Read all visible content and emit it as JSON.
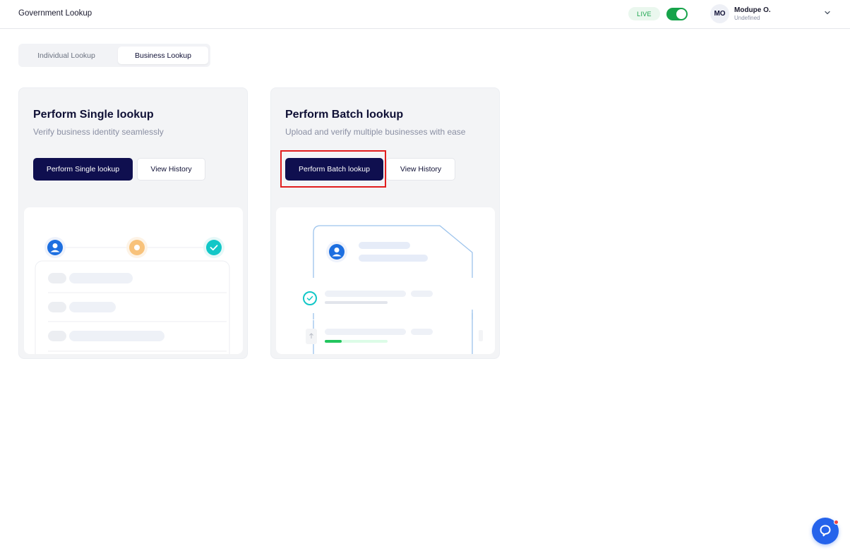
{
  "header": {
    "title": "Government Lookup",
    "live_label": "LIVE",
    "live_enabled": true,
    "user": {
      "initials": "MO",
      "name": "Modupe O.",
      "subtitle": "Undefined"
    }
  },
  "tabs": [
    {
      "label": "Individual Lookup",
      "active": false
    },
    {
      "label": "Business Lookup",
      "active": true
    }
  ],
  "cards": {
    "single": {
      "title": "Perform Single lookup",
      "subtitle": "Verify business identity seamlessly",
      "primary_label": "Perform Single lookup",
      "secondary_label": "View History"
    },
    "batch": {
      "title": "Perform Batch lookup",
      "subtitle": "Upload and verify multiple businesses with ease",
      "primary_label": "Perform Batch lookup",
      "secondary_label": "View History"
    }
  },
  "colors": {
    "primary": "#0f0f4f",
    "live_green": "#16a34a",
    "highlight": "#e11d1d",
    "help_blue": "#2563eb"
  },
  "icons": [
    "chevron-down-icon",
    "user-icon",
    "check-icon",
    "upload-icon",
    "help-icon"
  ]
}
